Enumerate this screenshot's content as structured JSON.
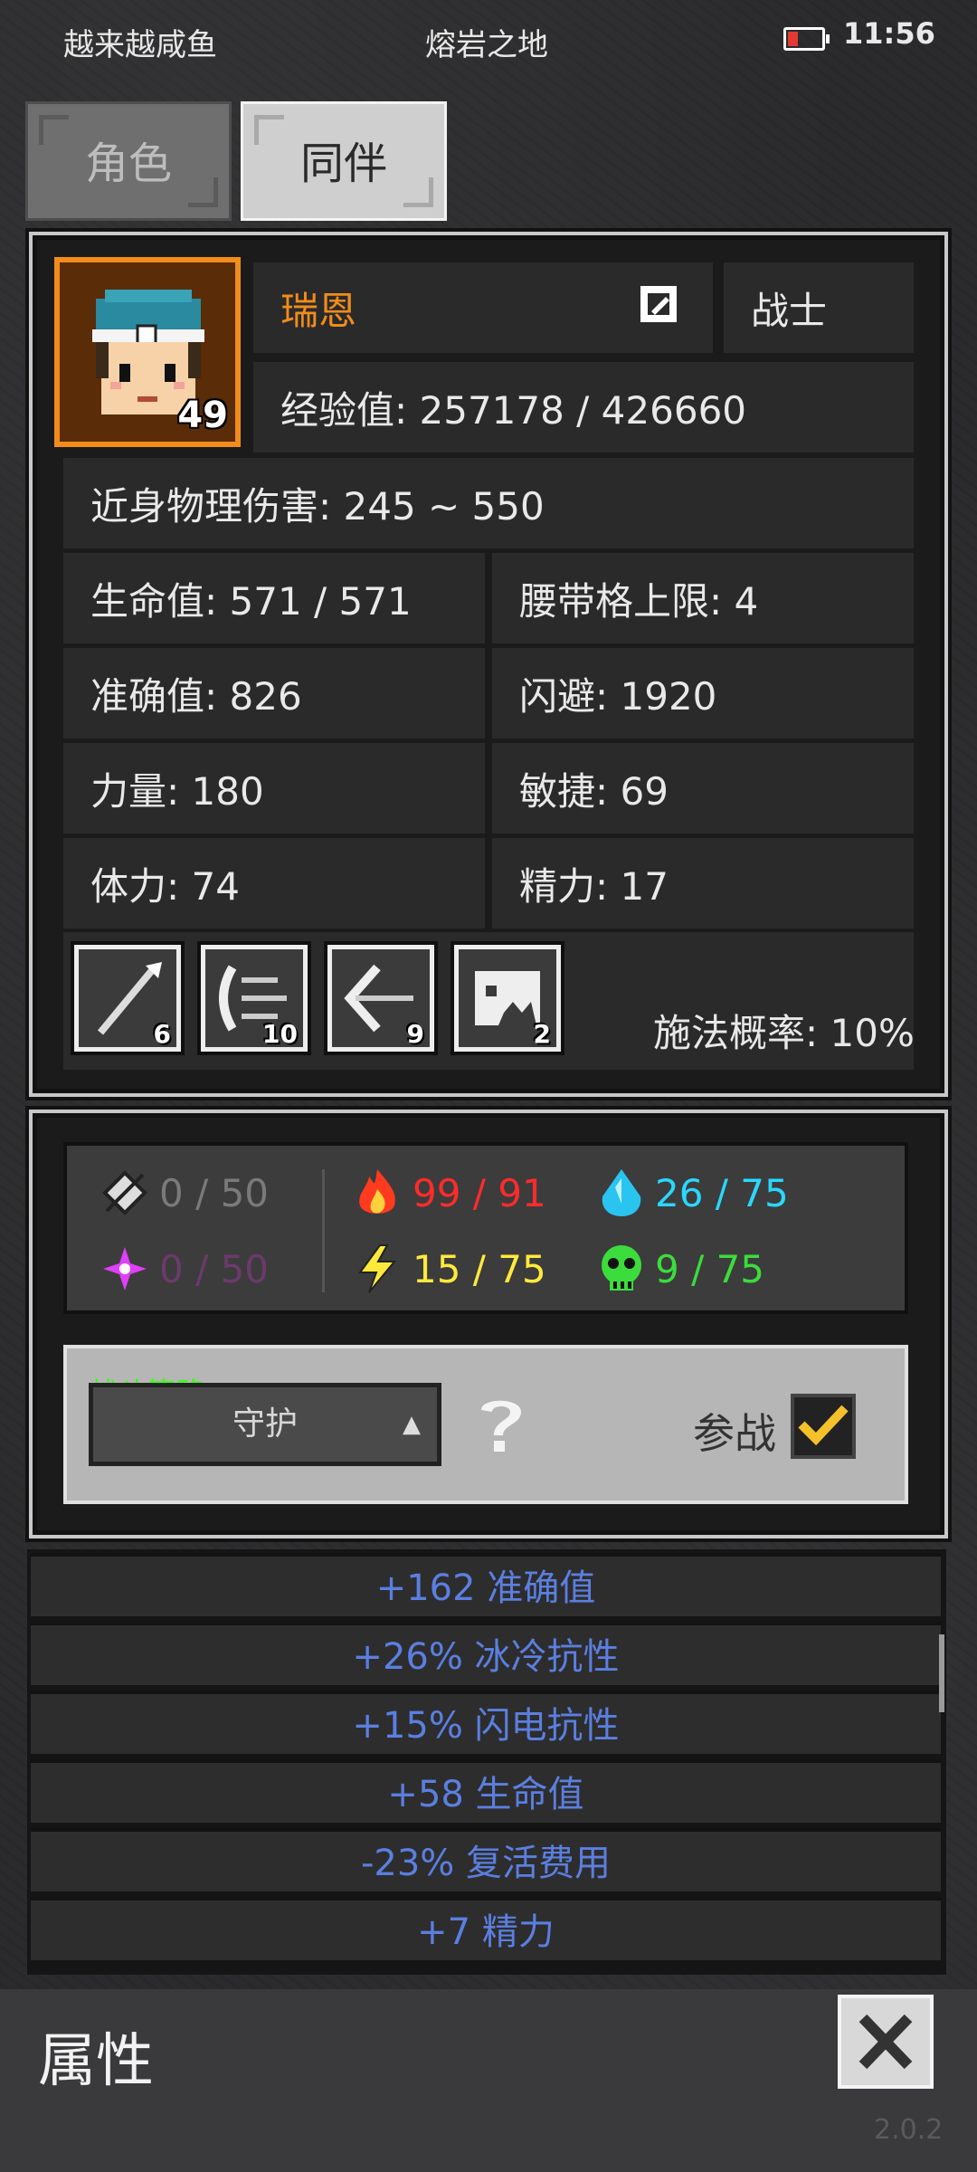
{
  "status_bar": {
    "app_name": "越来越咸鱼",
    "location": "熔岩之地",
    "time": "11:56",
    "battery_level": 0.3
  },
  "tabs": [
    {
      "label": "角色"
    },
    {
      "label": "同伴"
    }
  ],
  "character": {
    "level": "49",
    "name": "瑞恩",
    "class": "战士",
    "experience": "经验值: 257178 / 426660",
    "damage": "近身物理伤害: 245 ~ 550",
    "stats": [
      "生命值: 571 / 571",
      "腰带格上限: 4",
      "准确值: 826",
      "闪避: 1920",
      "力量: 180",
      "敏捷: 69",
      "体力: 74",
      "精力: 17"
    ],
    "skills": [
      {
        "icon": "spear-thrust-icon",
        "count": "6"
      },
      {
        "icon": "wind-blast-icon",
        "count": "10"
      },
      {
        "icon": "arrow-wave-icon",
        "count": "9"
      },
      {
        "icon": "beast-roar-icon",
        "count": "2"
      }
    ],
    "cast_rate": "施法概率: 10%"
  },
  "resistances": {
    "physical": "0 / 50",
    "fire": "99 / 91",
    "cold": "26 / 75",
    "magic": "0 / 50",
    "lightning": "15 / 75",
    "poison": "9 / 75",
    "colors": {
      "physical": "#7a7a7a",
      "fire": "#ff2b2b",
      "cold": "#29d8ff",
      "magic": "#6b3a6b",
      "lightning": "#ffea3b",
      "poison": "#3bdc3b"
    }
  },
  "strategy": {
    "label": "战斗策略",
    "value": "守护",
    "join_label": "参战",
    "join_checked": true
  },
  "bonuses": [
    "+162 准确值",
    "+26% 冰冷抗性",
    "+15% 闪电抗性",
    "+58 生命值",
    "-23% 复活费用",
    "+7 精力"
  ],
  "footer": {
    "title": "属性",
    "version": "2.0.2"
  }
}
